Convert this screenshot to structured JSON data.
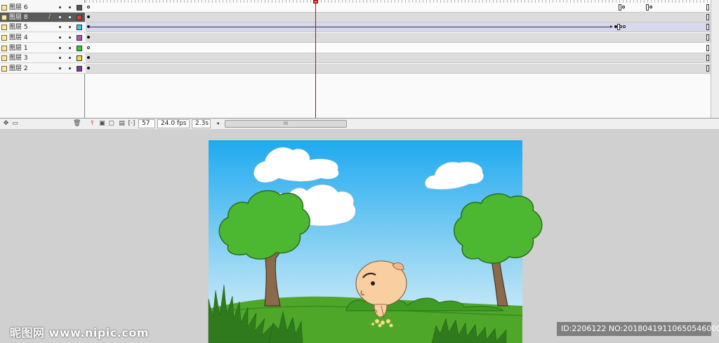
{
  "layers": [
    {
      "name": "图层 6",
      "color": "#555555",
      "selected": false
    },
    {
      "name": "图层 8",
      "color": "#d63a3a",
      "selected": true
    },
    {
      "name": "图层 5",
      "color": "#33ccee",
      "selected": false
    },
    {
      "name": "图层 4",
      "color": "#cc44cc",
      "selected": false
    },
    {
      "name": "图层 1",
      "color": "#33cc33",
      "selected": false
    },
    {
      "name": "图层 3",
      "color": "#e8e23a",
      "selected": false
    },
    {
      "name": "图层 2",
      "color": "#8833aa",
      "selected": false
    }
  ],
  "status": {
    "current_frame": "57",
    "frame_rate": "24.0 fps",
    "elapsed_time": "2.3s",
    "scroll_grip": "III"
  },
  "watermark": {
    "left": "昵图网 www.nipic.com",
    "right": "ID:2206122 NO:20180419110650546000"
  },
  "colors": {
    "sky_top": "#1eaaf0",
    "sky_bottom": "#e2f4fb",
    "grass": "#4fa72a",
    "tree_leaves": "#4cb832",
    "trunk": "#8a6a4a",
    "playhead": "#d80000"
  }
}
